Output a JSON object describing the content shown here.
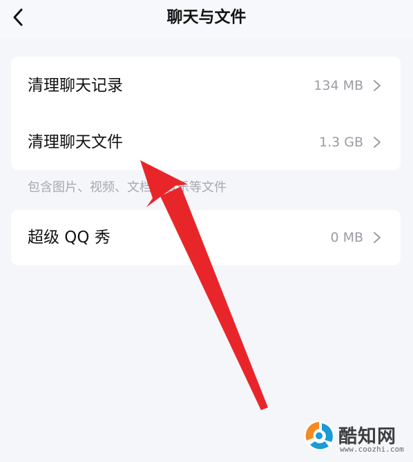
{
  "header": {
    "title": "聊天与文件",
    "back_icon": "chevron-left-icon"
  },
  "storage": {
    "items": [
      {
        "label": "清理聊天记录",
        "value": "134 MB"
      },
      {
        "label": "清理聊天文件",
        "value": "1.3 GB"
      }
    ],
    "note": "包含图片、视频、文档、音乐等文件"
  },
  "extras": {
    "items": [
      {
        "label": "超级 QQ 秀",
        "value": "0 MB"
      }
    ]
  },
  "annotation": {
    "arrow_color": "#e8262a"
  },
  "watermark": {
    "brand": "酷知网",
    "url": "www.coozhi.com",
    "logo_colors": [
      "#f28b22",
      "#1a9ad6"
    ]
  }
}
